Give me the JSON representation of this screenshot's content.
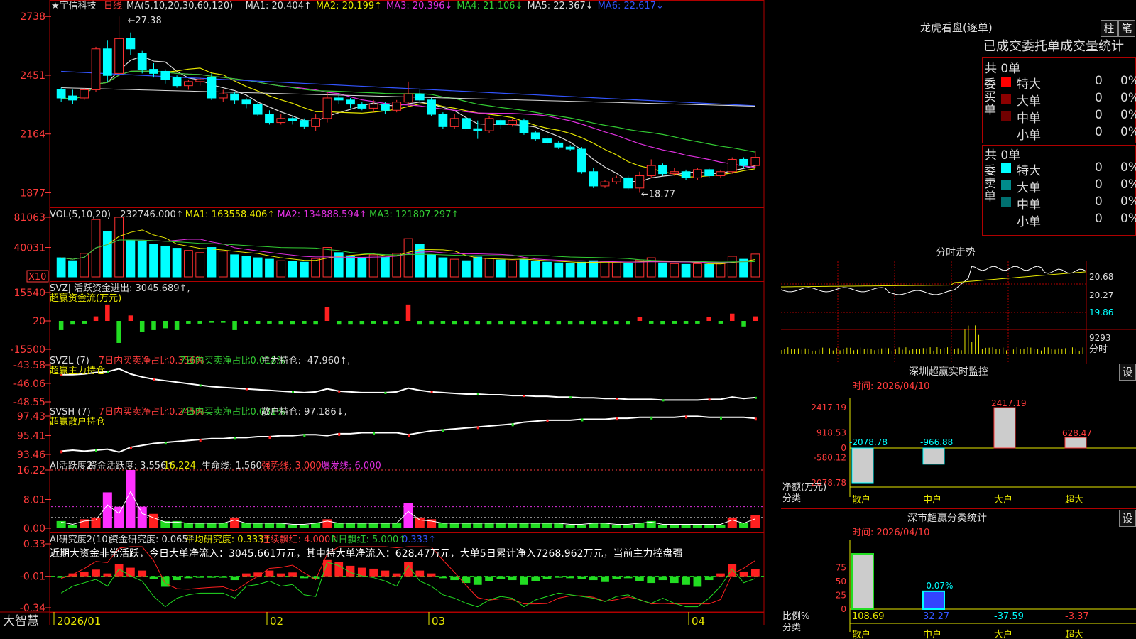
{
  "stock": {
    "name": "★宇信科技",
    "period": "日线"
  },
  "main_legend": [
    {
      "text": "MA(5,10,20,30,60,120)",
      "color": "#dddddd"
    },
    {
      "text": "MA1: 20.404↑",
      "color": "#dddddd"
    },
    {
      "text": "MA2: 20.199↑",
      "color": "#e8e800"
    },
    {
      "text": "MA3: 20.396↓",
      "color": "#e030e0"
    },
    {
      "text": "MA4: 21.106↓",
      "color": "#33cc33"
    },
    {
      "text": "MA5: 22.367↓",
      "color": "#dddddd"
    },
    {
      "text": "MA6: 22.617↓",
      "color": "#3355ff"
    }
  ],
  "main_axis": [
    "2738",
    "2451",
    "2164",
    "1877"
  ],
  "high_label": "27.38",
  "low_label": "18.77",
  "vol_legend": [
    {
      "text": "VOL(5,10,20)",
      "color": "#dddddd"
    },
    {
      "text": "232746.000↑",
      "color": "#dddddd"
    },
    {
      "text": "MA1: 163558.406↑",
      "color": "#e8e800"
    },
    {
      "text": "MA2: 134888.594↑",
      "color": "#e030e0"
    },
    {
      "text": "MA3: 121807.297↑",
      "color": "#33cc33"
    }
  ],
  "vol_axis": [
    "81063",
    "40031"
  ],
  "vol_unit": "X10",
  "svzj": {
    "legend": [
      {
        "text": "SVZJ  活跃资金进出: 3045.689↑,",
        "color": "#dddddd"
      }
    ],
    "sub": "超赢资金流(万元)",
    "axis": [
      "15540",
      "20",
      "-15500"
    ]
  },
  "svzl": {
    "legend": [
      {
        "text": "SVZL (7)",
        "color": "#dddddd"
      },
      {
        "text": "7日内买卖净占比0.356%",
        "color": "#ff3b3b"
      },
      {
        "text": "7日内买卖净占比0.018%",
        "color": "#33cc33"
      },
      {
        "text": "主力持仓: -47.960↑,",
        "color": "#dddddd"
      }
    ],
    "sub": "超赢主力持仓",
    "axis": [
      "-43.58",
      "-46.06",
      "-48.55"
    ]
  },
  "svsh": {
    "legend": [
      {
        "text": "SVSH (7)",
        "color": "#dddddd"
      },
      {
        "text": "7日内买卖净占比0.245%",
        "color": "#ff3b3b"
      },
      {
        "text": "7日内买卖净占比0.031%",
        "color": "#33cc33"
      },
      {
        "text": "散户持仓: 97.186↓,",
        "color": "#dddddd"
      }
    ],
    "sub": "超赢散户持仓",
    "axis": [
      "97.43",
      "95.41",
      "93.46"
    ]
  },
  "ai1": {
    "legend": [
      {
        "text": "AI活跃度2",
        "color": "#dddddd"
      },
      {
        "text": "资金活跃度: 3.556↑",
        "color": "#dddddd"
      },
      {
        "text": "16.224",
        "color": "#e8e800"
      },
      {
        "text": "生命线: 1.560",
        "color": "#dddddd"
      },
      {
        "text": "强势线: 3.000",
        "color": "#ff3b3b"
      },
      {
        "text": "爆发线: 6.000",
        "color": "#e030e0"
      }
    ],
    "axis": [
      "16.22",
      "8.01",
      "0.00"
    ]
  },
  "ai2": {
    "legend": [
      {
        "text": "AI研究度2(10)",
        "color": "#dddddd"
      },
      {
        "text": "资金研究度: 0.065↑",
        "color": "#dddddd"
      },
      {
        "text": "平均研究度: 0.333↑",
        "color": "#e8e800"
      },
      {
        "text": "连续飘红: 4.000↑",
        "color": "#ff3b3b"
      },
      {
        "text": "N日飘红: 5.000↑",
        "color": "#33cc33"
      },
      {
        "text": "0.333↑",
        "color": "#3355ff"
      }
    ],
    "summary": "近期大资金非常活跃，今日大单净流入：3045.661万元，其中特大单净流入：628.47万元，大单5日累计净入7268.962万元，当前主力控盘强",
    "axis": [
      "0.33",
      "-0.01",
      "-0.34"
    ]
  },
  "xaxis": {
    "labels": [
      "2026/01",
      "02",
      "03",
      "04"
    ],
    "brand": "大智慧"
  },
  "lhb": {
    "title": "龙虎看盘(逐单)",
    "btn1": "柱",
    "btn2": "笔",
    "header": "已成交委托单成交量统计",
    "buy": {
      "label": "委买单",
      "total": "共 0单",
      "rows": [
        {
          "name": "特大",
          "vol": "0",
          "pct": "0%",
          "color": "#ff0000"
        },
        {
          "name": "大单",
          "vol": "0",
          "pct": "0%",
          "color": "#8b0000"
        },
        {
          "name": "中单",
          "vol": "0",
          "pct": "0%",
          "color": "#700000"
        },
        {
          "name": "小单",
          "vol": "0",
          "pct": "0%",
          "color": "#000000"
        }
      ]
    },
    "sell": {
      "label": "委卖单",
      "total": "共 0单",
      "rows": [
        {
          "name": "特大",
          "vol": "0",
          "pct": "0%",
          "color": "#00ffff"
        },
        {
          "name": "大单",
          "vol": "0",
          "pct": "0%",
          "color": "#008b8b"
        },
        {
          "name": "中单",
          "vol": "0",
          "pct": "0%",
          "color": "#007070"
        },
        {
          "name": "小单",
          "vol": "0",
          "pct": "0%",
          "color": "#000000"
        }
      ]
    }
  },
  "fenshi": {
    "title": "分时走势",
    "axis": [
      "20.68",
      "20.27",
      "19.86"
    ],
    "vol": "9293",
    "unit": "分时"
  },
  "monitor": {
    "title": "深圳超赢实时监控",
    "set": "设",
    "time": "时间: 2026/04/10",
    "ylabels": [
      "2417.19",
      "918.53",
      "0",
      "-580.12",
      "-2078.78"
    ],
    "yunit": "净额(万元)",
    "xunit": "分类"
  },
  "stats": {
    "title": "深市超赢分类统计",
    "set": "设",
    "time": "时间: 2026/04/10",
    "ylabels": [
      "75",
      "50",
      "25",
      "0"
    ],
    "yunit": "比例%",
    "xunit": "分类"
  },
  "chart_data": [
    {
      "type": "candlestick",
      "name": "daily_k",
      "ylim": [
        18.77,
        27.38
      ],
      "ohlc": [
        [
          23.8,
          23.4,
          23.9,
          23.2
        ],
        [
          23.5,
          23.3,
          23.8,
          23.1
        ],
        [
          23.4,
          23.8,
          23.9,
          23.3
        ],
        [
          23.8,
          25.8,
          25.9,
          23.7
        ],
        [
          25.8,
          24.5,
          26.2,
          24.2
        ],
        [
          24.6,
          26.3,
          27.38,
          24.5
        ],
        [
          26.3,
          25.8,
          26.6,
          25.5
        ],
        [
          25.6,
          24.8,
          25.7,
          24.6
        ],
        [
          24.8,
          24.6,
          25.1,
          24.4
        ],
        [
          24.7,
          24.3,
          24.8,
          24.1
        ],
        [
          24.4,
          24.0,
          24.5,
          23.9
        ],
        [
          24.0,
          24.2,
          24.3,
          23.8
        ],
        [
          24.2,
          24.3,
          24.4,
          24.0
        ],
        [
          24.4,
          23.4,
          24.6,
          23.3
        ],
        [
          23.4,
          23.6,
          23.8,
          23.2
        ],
        [
          23.6,
          23.3,
          23.7,
          23.1
        ],
        [
          23.3,
          23.1,
          23.4,
          22.9
        ],
        [
          23.1,
          22.6,
          23.2,
          22.5
        ],
        [
          22.6,
          22.2,
          22.8,
          22.1
        ],
        [
          22.2,
          22.4,
          22.6,
          22.1
        ],
        [
          22.4,
          22.3,
          22.5,
          22.1
        ],
        [
          22.3,
          22.0,
          22.4,
          21.9
        ],
        [
          22.0,
          22.4,
          22.6,
          21.8
        ],
        [
          22.4,
          23.4,
          23.7,
          22.2
        ],
        [
          23.4,
          23.3,
          23.6,
          23.1
        ],
        [
          23.3,
          23.1,
          23.4,
          22.9
        ],
        [
          23.1,
          22.9,
          23.2,
          22.8
        ],
        [
          22.9,
          23.1,
          23.3,
          22.7
        ],
        [
          23.1,
          22.8,
          23.2,
          22.6
        ],
        [
          22.8,
          23.2,
          23.3,
          22.7
        ],
        [
          23.2,
          23.6,
          24.2,
          23.0
        ],
        [
          23.6,
          23.3,
          23.8,
          23.2
        ],
        [
          23.3,
          22.6,
          23.4,
          22.5
        ],
        [
          22.6,
          22.0,
          22.7,
          21.9
        ],
        [
          22.0,
          22.4,
          22.6,
          21.9
        ],
        [
          22.4,
          21.9,
          22.5,
          21.8
        ],
        [
          21.9,
          21.8,
          22.3,
          21.4
        ],
        [
          21.8,
          22.4,
          22.5,
          21.7
        ],
        [
          22.3,
          22.1,
          22.4,
          21.9
        ],
        [
          22.1,
          22.3,
          22.4,
          22.0
        ],
        [
          22.3,
          21.7,
          22.4,
          21.6
        ],
        [
          21.7,
          21.4,
          21.8,
          21.3
        ],
        [
          21.4,
          21.2,
          21.6,
          21.1
        ],
        [
          21.2,
          21.0,
          21.3,
          20.9
        ],
        [
          21.0,
          20.9,
          21.1,
          20.8
        ],
        [
          20.9,
          19.8,
          21.0,
          19.7
        ],
        [
          19.8,
          19.1,
          20.0,
          19.0
        ],
        [
          19.1,
          19.3,
          19.4,
          19.0
        ],
        [
          19.3,
          19.5,
          19.6,
          19.2
        ],
        [
          19.5,
          19.0,
          19.6,
          18.9
        ],
        [
          19.0,
          19.6,
          19.8,
          18.77
        ],
        [
          19.6,
          20.1,
          20.4,
          19.5
        ],
        [
          20.1,
          19.7,
          20.2,
          19.6
        ],
        [
          19.7,
          19.8,
          20.0,
          19.6
        ],
        [
          19.8,
          19.5,
          19.9,
          19.4
        ],
        [
          19.5,
          19.9,
          20.0,
          19.4
        ],
        [
          19.9,
          19.6,
          20.0,
          19.5
        ],
        [
          19.6,
          19.8,
          19.9,
          19.5
        ],
        [
          19.8,
          20.4,
          20.5,
          19.7
        ],
        [
          20.4,
          20.1,
          20.5,
          20.0
        ],
        [
          20.1,
          20.5,
          20.8,
          20.0
        ]
      ]
    },
    {
      "type": "bar",
      "name": "volume",
      "ylim": [
        0,
        81063
      ],
      "values": [
        26000,
        22000,
        32000,
        78000,
        62000,
        81063,
        50000,
        48000,
        44000,
        42000,
        39000,
        36000,
        33000,
        40000,
        35000,
        30000,
        28000,
        26000,
        24000,
        22000,
        21000,
        20000,
        25000,
        40000,
        33000,
        28000,
        26000,
        30000,
        27000,
        32000,
        52000,
        44000,
        30000,
        26000,
        24000,
        22000,
        27000,
        25000,
        23000,
        22000,
        24000,
        21000,
        20000,
        19000,
        18000,
        20000,
        22000,
        21000,
        19000,
        18000,
        23000,
        26000,
        19000,
        18000,
        17000,
        18000,
        17000,
        18000,
        28000,
        24000,
        31000
      ]
    },
    {
      "type": "bar",
      "name": "svzj",
      "ylim": [
        -15500,
        15540
      ],
      "values": [
        -5000,
        -2000,
        -1500,
        2500,
        9000,
        -12000,
        3000,
        -6000,
        -5000,
        -4000,
        -5000,
        -1500,
        -1500,
        -1000,
        -1000,
        -5000,
        -1500,
        -1500,
        -1500,
        -2000,
        -2000,
        -1500,
        -2000,
        7500,
        -2000,
        -2000,
        -2000,
        -1500,
        -2000,
        -1500,
        9000,
        -2000,
        -2000,
        -1500,
        -2000,
        -2000,
        -2000,
        -2000,
        -2000,
        -2000,
        -2000,
        -2000,
        -2000,
        -2000,
        -2000,
        -2000,
        -2000,
        -2000,
        -2000,
        -2000,
        2000,
        -1500,
        -2000,
        -1500,
        -1500,
        -1500,
        2000,
        -1500,
        4000,
        -3000,
        2500
      ]
    },
    {
      "type": "line",
      "name": "svzl",
      "ylim": [
        -48.55,
        -43.58
      ],
      "values": [
        -44.9,
        -44.9,
        -44.8,
        -44.6,
        -44.5,
        -44.1,
        -44.8,
        -45.2,
        -45.5,
        -45.7,
        -45.9,
        -46.1,
        -46.3,
        -46.5,
        -46.6,
        -46.7,
        -46.8,
        -46.9,
        -47.0,
        -47.1,
        -47.2,
        -47.3,
        -47.2,
        -46.8,
        -47.1,
        -47.2,
        -47.3,
        -47.3,
        -47.3,
        -47.2,
        -46.7,
        -47.0,
        -47.2,
        -47.3,
        -47.4,
        -47.5,
        -47.5,
        -47.6,
        -47.6,
        -47.7,
        -47.7,
        -47.8,
        -47.8,
        -47.9,
        -47.9,
        -48.0,
        -48.0,
        -48.1,
        -48.1,
        -48.2,
        -48.2,
        -48.2,
        -48.3,
        -48.3,
        -48.3,
        -48.3,
        -48.2,
        -48.2,
        -47.9,
        -48.1,
        -47.96
      ]
    },
    {
      "type": "line",
      "name": "svsh",
      "ylim": [
        93.46,
        97.43
      ],
      "values": [
        93.8,
        93.9,
        93.8,
        93.9,
        94.0,
        93.7,
        94.2,
        94.4,
        94.6,
        94.7,
        94.8,
        94.9,
        95.0,
        95.1,
        95.1,
        95.2,
        95.2,
        95.3,
        95.3,
        95.4,
        95.4,
        95.5,
        95.5,
        95.4,
        95.6,
        95.6,
        95.7,
        95.7,
        95.7,
        95.7,
        95.5,
        95.7,
        95.9,
        96.0,
        96.1,
        96.2,
        96.3,
        96.4,
        96.5,
        96.6,
        96.8,
        96.9,
        97.0,
        97.0,
        97.0,
        97.1,
        97.1,
        97.1,
        97.2,
        97.2,
        97.3,
        97.3,
        97.3,
        97.3,
        97.4,
        97.4,
        97.3,
        97.3,
        97.3,
        97.3,
        97.19
      ]
    },
    {
      "type": "bar",
      "name": "ai_activity",
      "ylim": [
        0,
        16.22
      ],
      "values": [
        2.0,
        1.0,
        2.5,
        3.0,
        10.0,
        6.0,
        16.22,
        6.0,
        4.0,
        2.0,
        2.0,
        1.5,
        1.5,
        1.5,
        1.5,
        3.0,
        1.5,
        1.5,
        1.5,
        1.5,
        1.0,
        1.0,
        1.5,
        2.5,
        1.5,
        1.5,
        1.5,
        1.5,
        1.5,
        1.5,
        7.0,
        3.0,
        2.5,
        1.5,
        1.5,
        1.5,
        1.5,
        1.5,
        1.5,
        1.5,
        1.5,
        1.5,
        1.5,
        1.5,
        1.0,
        1.0,
        1.5,
        1.5,
        1.0,
        1.0,
        1.5,
        2.0,
        1.0,
        1.0,
        1.0,
        1.0,
        1.0,
        1.0,
        3.0,
        1.5,
        3.556
      ]
    },
    {
      "type": "bar",
      "name": "ai_research",
      "ylim": [
        -0.34,
        0.33
      ],
      "values": [
        -0.02,
        0.02,
        0.04,
        0.06,
        0.02,
        0.12,
        0.08,
        0.05,
        -0.04,
        -0.12,
        -0.05,
        -0.03,
        -0.02,
        -0.02,
        -0.02,
        -0.05,
        0.02,
        0.03,
        0.05,
        0.02,
        0.03,
        -0.03,
        -0.04,
        0.16,
        0.14,
        0.1,
        0.08,
        0.07,
        0.05,
        0.02,
        0.14,
        0.05,
        0.02,
        -0.03,
        -0.05,
        -0.08,
        -0.1,
        -0.06,
        -0.04,
        -0.05,
        -0.1,
        -0.06,
        -0.04,
        -0.02,
        -0.03,
        -0.04,
        -0.05,
        -0.07,
        -0.04,
        -0.03,
        -0.06,
        -0.08,
        -0.05,
        -0.08,
        -0.1,
        -0.12,
        -0.05,
        0.02,
        0.12,
        0.04,
        0.065
      ]
    },
    {
      "type": "bar",
      "name": "monitor",
      "categories": [
        "散户",
        "中户",
        "大户",
        "超大"
      ],
      "values": [
        -2078.78,
        -966.88,
        2417.19,
        628.47
      ],
      "ylim": [
        -2078.78,
        2417.19
      ]
    },
    {
      "type": "bar",
      "name": "stats",
      "categories": [
        "散户",
        "中户",
        "大户",
        "超大"
      ],
      "values": [
        108.69,
        32.27,
        -37.59,
        -3.37
      ],
      "labels": [
        "108.69",
        "32.27",
        "-37.59",
        "-3.37"
      ],
      "extra_label": "-0.07%",
      "ylim": [
        0,
        100
      ]
    }
  ]
}
